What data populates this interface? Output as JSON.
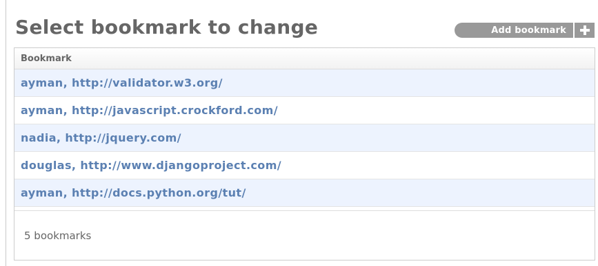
{
  "header": {
    "title": "Select bookmark to change",
    "add_button_label": "Add bookmark"
  },
  "table": {
    "column_header": "Bookmark",
    "rows": [
      "ayman, http://validator.w3.org/",
      "ayman, http://javascript.crockford.com/",
      "nadia, http://jquery.com/",
      "douglas, http://www.djangoproject.com/",
      "ayman, http://docs.python.org/tut/"
    ]
  },
  "paginator": {
    "count_text": "5 bookmarks"
  },
  "colors": {
    "link": "#5b80b2",
    "row_alt": "#edf3fe",
    "button": "#999999",
    "title": "#666666"
  },
  "icons": {
    "add": "plus-icon"
  }
}
